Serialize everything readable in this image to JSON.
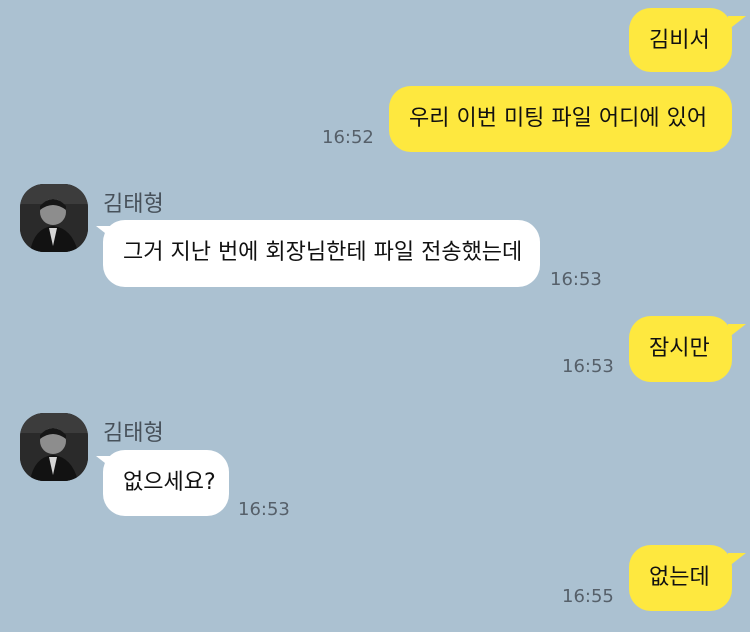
{
  "messages": [
    {
      "type": "out",
      "text": "김비서",
      "time": ""
    },
    {
      "type": "out",
      "text": "우리 이번 미팅 파일 어디에 있어",
      "time": "16:52"
    },
    {
      "type": "in",
      "sender": "김태형",
      "text": "그거 지난 번에 회장님한테 파일 전송했는데",
      "time": "16:53"
    },
    {
      "type": "out",
      "text": "잠시만",
      "time": "16:53"
    },
    {
      "type": "in",
      "sender": "김태형",
      "text": "없으세요?",
      "time": "16:53"
    },
    {
      "type": "out",
      "text": "없는데",
      "time": "16:55"
    }
  ],
  "colors": {
    "background": "#abc1d1",
    "outgoing": "#fee83f",
    "incoming": "#ffffff"
  },
  "icons": {
    "avatar": "profile-photo-avatar-icon"
  }
}
